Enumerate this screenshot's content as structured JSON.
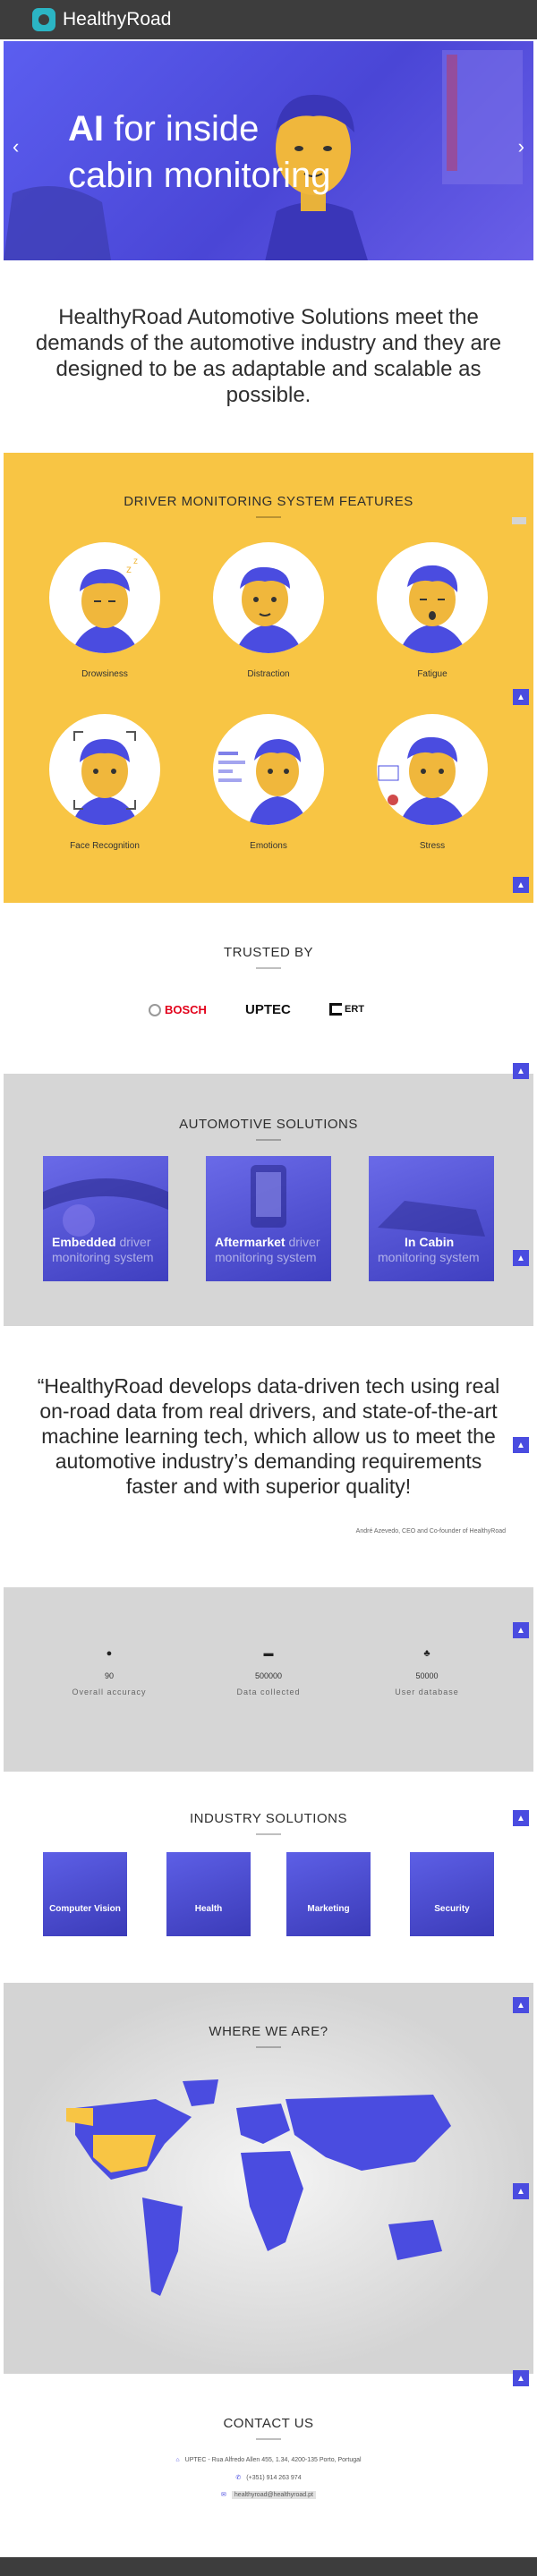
{
  "brand": {
    "name": "HealthyRoad"
  },
  "hero": {
    "title_bold": "AI",
    "title_rest_line1": " for inside",
    "title_line2": "cabin monitoring",
    "prev_arrow": "‹",
    "next_arrow": "›"
  },
  "intro": {
    "text": "HealthyRoad Automotive Solutions meet the demands of the automotive industry and they are designed to be as adaptable and scalable as possible."
  },
  "features": {
    "title": "DRIVER MONITORING SYSTEM FEATURES",
    "items": [
      {
        "label": "Drowsiness"
      },
      {
        "label": "Distraction"
      },
      {
        "label": "Fatigue"
      },
      {
        "label": "Face Recognition"
      },
      {
        "label": "Emotions"
      },
      {
        "label": "Stress"
      }
    ]
  },
  "trusted": {
    "title": "TRUSTED BY",
    "logos": [
      "BOSCH",
      "UPTEC",
      "ERT"
    ]
  },
  "automotive": {
    "title": "AUTOMOTIVE SOLUTIONS",
    "cards": [
      {
        "bold": "Embedded",
        "rest": " driver",
        "line2": "monitoring system"
      },
      {
        "bold": "Aftermarket",
        "rest": " driver",
        "line2": "monitoring system"
      },
      {
        "bold": "In Cabin",
        "rest": "",
        "line2": "monitoring system"
      }
    ]
  },
  "quote": {
    "text": "“HealthyRoad develops data-driven tech using real on-road data from real drivers, and state-of-the-art machine learning tech, which allow us to meet the automotive industry’s demanding requirements faster and with superior quality!",
    "author": "André Azevedo, CEO and Co-founder of HealthyRoad"
  },
  "stats": [
    {
      "icon": "●",
      "value": "90",
      "label": "Overall accuracy"
    },
    {
      "icon": "▬",
      "value": "500000",
      "label": "Data collected"
    },
    {
      "icon": "♣",
      "value": "50000",
      "label": "User database"
    }
  ],
  "industry": {
    "title": "INDUSTRY SOLUTIONS",
    "cards": [
      {
        "label": "Computer Vision"
      },
      {
        "label": "Health"
      },
      {
        "label": "Marketing"
      },
      {
        "label": "Security"
      }
    ]
  },
  "where": {
    "title": "WHERE WE ARE?"
  },
  "contact": {
    "title": "CONTACT US",
    "address": "UPTEC - Rua Alfredo Allen 455, 1.34, 4200-135 Porto, Portugal",
    "phone": "(+351) 914 263 974",
    "email": "healthyroad@healthyroad.pt"
  },
  "colors": {
    "accent": "#4a4ce0",
    "yellow": "#f8c544",
    "topbar": "#3d3d3d"
  }
}
